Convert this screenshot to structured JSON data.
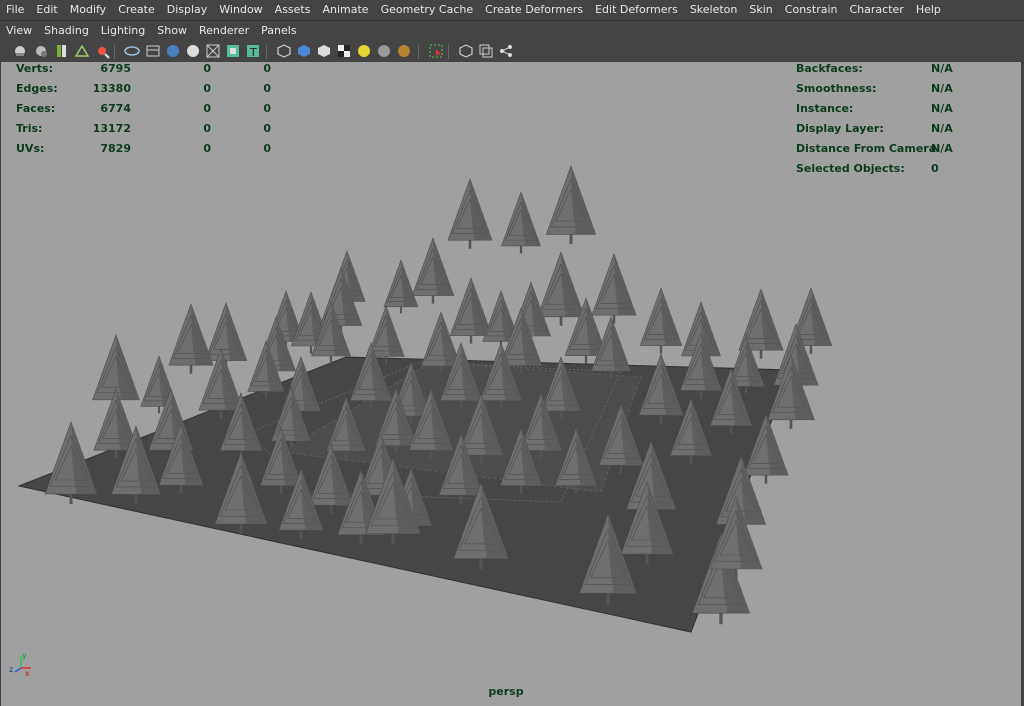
{
  "menubar": {
    "items": [
      "File",
      "Edit",
      "Modify",
      "Create",
      "Display",
      "Window",
      "Assets",
      "Animate",
      "Geometry Cache",
      "Create Deformers",
      "Edit Deformers",
      "Skeleton",
      "Skin",
      "Constrain",
      "Character",
      "Help"
    ]
  },
  "panel_menu": {
    "items": [
      "View",
      "Shading",
      "Lighting",
      "Show",
      "Renderer",
      "Panels"
    ]
  },
  "toolbar": {
    "icons": [
      "camera-select-icon",
      "camera-attributes-icon",
      "bookmarks-icon",
      "image-plane-icon",
      "two-d-pan-zoom-icon",
      "grid-icon",
      "film-gate-icon",
      "resolution-gate-icon",
      "gate-mask-icon",
      "field-chart-icon",
      "safe-action-icon",
      "safe-title-icon",
      "wireframe-icon",
      "smooth-shade-icon",
      "default-material-icon",
      "textured-icon",
      "use-all-lights-icon",
      "shadows-icon",
      "screen-space-ao-icon",
      "isolate-select-icon",
      "xray-icon",
      "xray-joints-icon",
      "backface-icon"
    ]
  },
  "hud_left": {
    "rows": [
      {
        "label": "Verts:",
        "total": "6795",
        "sel": "0",
        "comp": "0"
      },
      {
        "label": "Edges:",
        "total": "13380",
        "sel": "0",
        "comp": "0"
      },
      {
        "label": "Faces:",
        "total": "6774",
        "sel": "0",
        "comp": "0"
      },
      {
        "label": "Tris:",
        "total": "13172",
        "sel": "0",
        "comp": "0"
      },
      {
        "label": "UVs:",
        "total": "7829",
        "sel": "0",
        "comp": "0"
      }
    ]
  },
  "hud_right": {
    "rows": [
      {
        "label": "Backfaces:",
        "value": "N/A"
      },
      {
        "label": "Smoothness:",
        "value": "N/A"
      },
      {
        "label": "Instance:",
        "value": "N/A"
      },
      {
        "label": "Display Layer:",
        "value": "N/A"
      },
      {
        "label": "Distance From Camera:",
        "value": "N/A"
      },
      {
        "label": "Selected Objects:",
        "value": "0"
      }
    ]
  },
  "viewport": {
    "camera_label": "persp",
    "background_color": "#a0a0a0",
    "ground_color": "#464646",
    "tree_color": "#6e6e6e"
  },
  "axis": {
    "x": "x",
    "y": "y",
    "z": "z"
  }
}
